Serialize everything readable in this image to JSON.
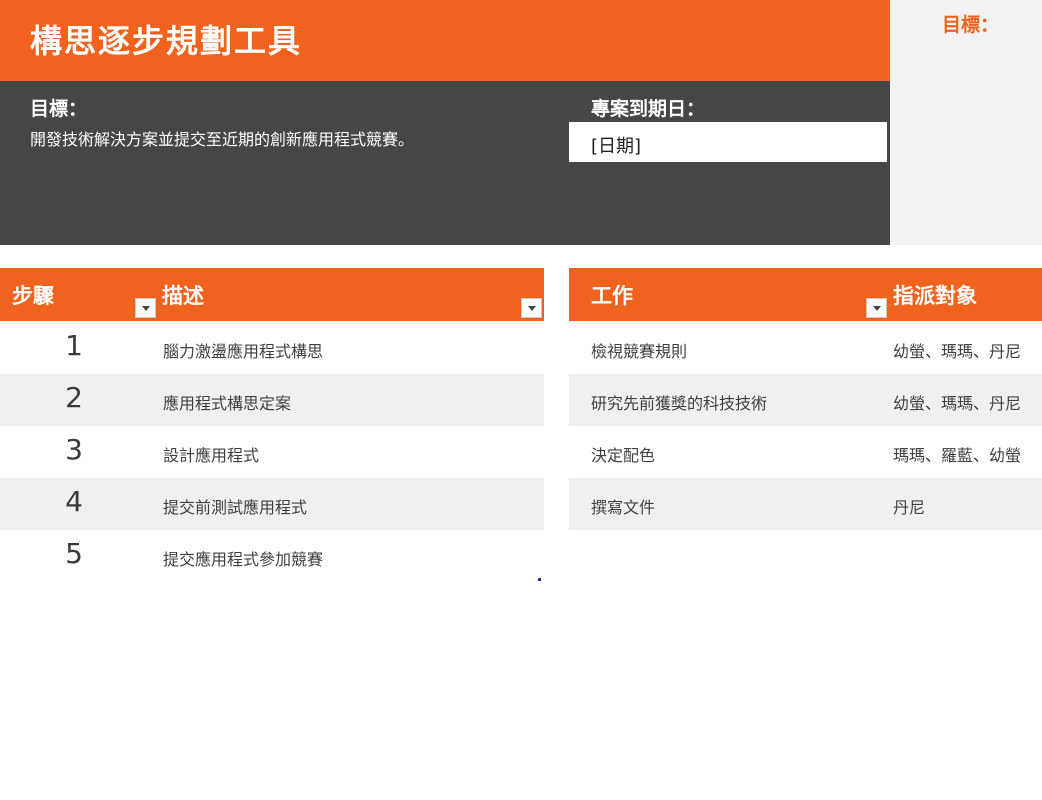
{
  "header": {
    "title": "構思逐步規劃工具",
    "goal_label": "目標：",
    "goal_text": "開發技術解決方案並提交至近期的創新應用程式競賽。",
    "due_label": "專案到期日：",
    "due_value": "[日期]"
  },
  "side_panel": {
    "goal_label": "目標："
  },
  "steps_table": {
    "headers": {
      "step": "步驟",
      "description": "描述"
    },
    "rows": [
      {
        "step": "1",
        "description": "腦力激盪應用程式構思"
      },
      {
        "step": "2",
        "description": "應用程式構思定案"
      },
      {
        "step": "3",
        "description": "設計應用程式"
      },
      {
        "step": "4",
        "description": "提交前測試應用程式"
      },
      {
        "step": "5",
        "description": "提交應用程式參加競賽"
      }
    ]
  },
  "tasks_table": {
    "headers": {
      "task": "工作",
      "assignee": "指派對象"
    },
    "rows": [
      {
        "task": "檢視競賽規則",
        "assignee": "幼螢、瑪瑪、丹尼"
      },
      {
        "task": "研究先前獲獎的科技技術",
        "assignee": "幼螢、瑪瑪、丹尼"
      },
      {
        "task": "決定配色",
        "assignee": "瑪瑪、羅藍、幼螢"
      },
      {
        "task": "撰寫文件",
        "assignee": "丹尼"
      }
    ]
  },
  "colors": {
    "accent": "#f0631f",
    "dark_band": "#464646",
    "alt_row": "#f0f0f0"
  },
  "icons": {
    "filter": "chevron-down-icon"
  }
}
